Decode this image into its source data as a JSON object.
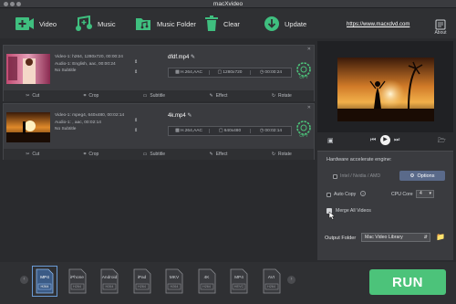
{
  "app": {
    "title": "macXvideo"
  },
  "toolbar": {
    "video": "Video",
    "music": "Music",
    "music_folder": "Music Folder",
    "clear": "Clear",
    "update": "Update",
    "website": "https://www.macxdvd.com",
    "about": "About"
  },
  "items": [
    {
      "src_video": "Video-1: h264, 1280x720, 00:00:24",
      "src_audio": "Audio-1: English, aac, 00:00:24",
      "src_subtitle": "No Subtitle",
      "out_name": "dfdf.mp4",
      "codec": "H.264,AAC",
      "resolution": "1280x720",
      "duration": "00:00:24",
      "opt": "OPT"
    },
    {
      "src_video": "Video-1: mpeg4, 640x480, 00:02:14",
      "src_audio": "Audio-1: , aac, 00:02:14",
      "src_subtitle": "No Subtitle",
      "out_name": "4k.mp4",
      "codec": "H.264,AAC",
      "resolution": "640x480",
      "duration": "00:02:14",
      "opt": "OPT"
    }
  ],
  "actions": {
    "cut": "Cut",
    "crop": "Crop",
    "subtitle": "Subtitle",
    "effect": "Effect",
    "rotate": "Rotate"
  },
  "settings": {
    "hw_title": "Hardware accelerate engine:",
    "hw_option": "Intel / Nvidia / AMD",
    "options_btn": "Options",
    "auto_copy": "Auto Copy",
    "cpu_core_label": "CPU Core",
    "cpu_core_value": "4",
    "merge_all": "Merge All Videos",
    "output_folder_label": "Output Folder",
    "output_folder_value": "Mac Video Library"
  },
  "formats": [
    {
      "name": "MP4",
      "codec": "H264",
      "selected": true
    },
    {
      "name": "iPhone",
      "codec": "H264"
    },
    {
      "name": "Android",
      "codec": "H264"
    },
    {
      "name": "iPad",
      "codec": "H264"
    },
    {
      "name": "MKV",
      "codec": "H264"
    },
    {
      "name": "4K",
      "codec": "H264"
    },
    {
      "name": "MP4",
      "codec": "HEVC"
    },
    {
      "name": "AVI",
      "codec": "H264"
    }
  ],
  "run": "RUN",
  "colors": {
    "accent": "#4cc37a",
    "toolbar_icon": "#3fbf7f",
    "options_btn": "#5a6a8a"
  }
}
